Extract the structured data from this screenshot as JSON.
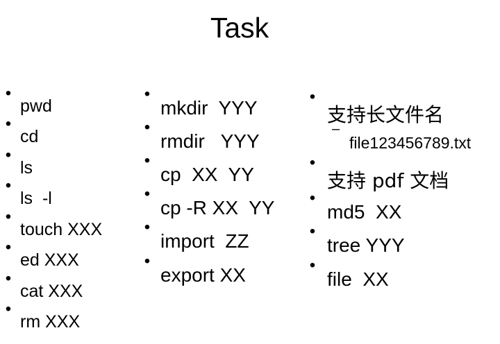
{
  "title": "Task",
  "column1": [
    "pwd",
    "cd",
    "ls",
    "ls  -l",
    "touch XXX",
    "ed XXX",
    "cat XXX",
    "rm XXX"
  ],
  "column2": [
    "mkdir  YYY",
    "rmdir   YYY",
    "cp  XX  YY",
    "cp -R XX  YY",
    "import  ZZ",
    "export XX"
  ],
  "column3": {
    "item1": "支持长文件名",
    "sub1": "file123456789.txt",
    "item2": "支持 pdf 文档",
    "item3": "md5  XX",
    "item4": "tree YYY",
    "item5": "file  XX"
  },
  "bullet_char": "•",
  "sub_bullet_char": "–"
}
